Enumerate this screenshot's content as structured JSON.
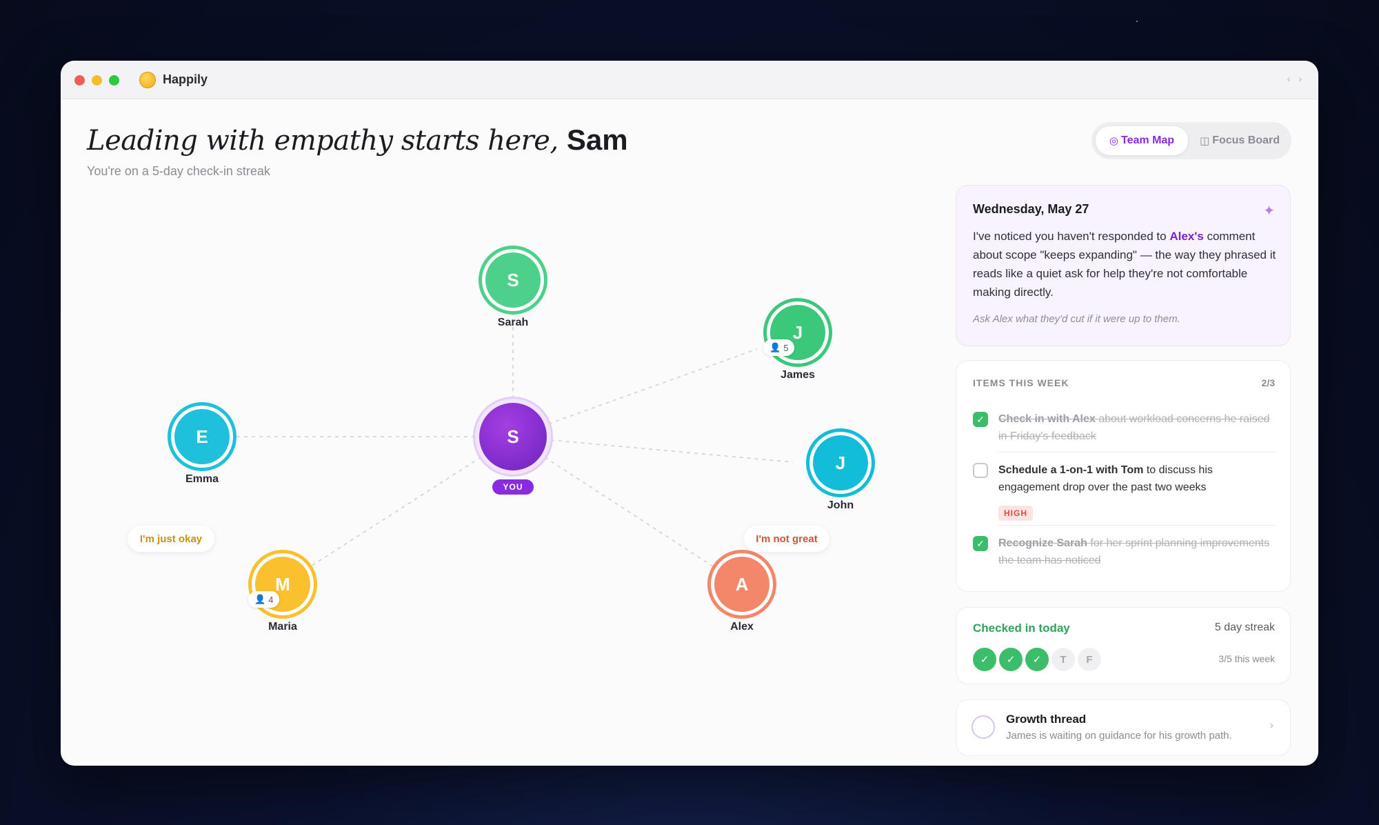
{
  "app": {
    "title": "Happily"
  },
  "header": {
    "greeting_italic": "Leading with empathy starts here,",
    "greeting_name": "Sam",
    "subtitle": "You're on a 5-day check-in streak"
  },
  "view_toggle": {
    "team_map": {
      "icon": "◎",
      "label": "Team Map"
    },
    "focus_board": {
      "icon": "◫",
      "label": "Focus Board"
    }
  },
  "team_map": {
    "center": {
      "initial": "S",
      "tag": "YOU",
      "color": "#8a2be2"
    },
    "members": [
      {
        "id": "sarah",
        "initial": "S",
        "name": "Sarah",
        "color": "#4cd08a"
      },
      {
        "id": "james",
        "initial": "J",
        "name": "James",
        "color": "#3cc87a",
        "count": "5"
      },
      {
        "id": "emma",
        "initial": "E",
        "name": "Emma",
        "color": "#1fc0dc"
      },
      {
        "id": "john",
        "initial": "J",
        "name": "John",
        "color": "#12bdd9"
      },
      {
        "id": "maria",
        "initial": "M",
        "name": "Maria",
        "color": "#fbc02d",
        "count": "4"
      },
      {
        "id": "alex",
        "initial": "A",
        "name": "Alex",
        "color": "#f4876a"
      }
    ],
    "moods": {
      "maria": {
        "text": "I'm just okay",
        "color": "#c89210"
      },
      "alex": {
        "text": "I'm not great",
        "color": "#d0533a"
      }
    }
  },
  "insight": {
    "date": "Wednesday, May 27",
    "body_pre": "I've noticed you haven't responded to ",
    "body_highlight": "Alex's",
    "body_post": " comment about scope \"keeps expanding\" — the way they phrased it reads like a quiet ask for help they're not comfortable making directly.",
    "prompt": "Ask Alex what they'd cut if it were up to them."
  },
  "items": {
    "heading": "ITEMS THIS WEEK",
    "count": "2/3",
    "list": [
      {
        "bold": "Check in with Alex",
        "rest": " about workload concerns he raised in Friday's feedback",
        "done": true
      },
      {
        "bold": "Schedule a 1-on-1 with Tom",
        "rest": " to discuss his engagement drop over the past two weeks",
        "done": false,
        "priority": "HIGH"
      },
      {
        "bold": "Recognize Sarah",
        "rest": " for her sprint planning improvements the team has noticed",
        "done": true
      }
    ]
  },
  "checkin": {
    "title": "Checked in today",
    "streak": "5 day streak",
    "days": [
      {
        "label": "✓",
        "done": true
      },
      {
        "label": "✓",
        "done": true
      },
      {
        "label": "✓",
        "done": true
      },
      {
        "label": "T",
        "done": false
      },
      {
        "label": "F",
        "done": false
      }
    ],
    "week": "3/5 this week"
  },
  "growth": {
    "title": "Growth thread",
    "subtitle": "James is waiting on guidance for his growth path."
  }
}
